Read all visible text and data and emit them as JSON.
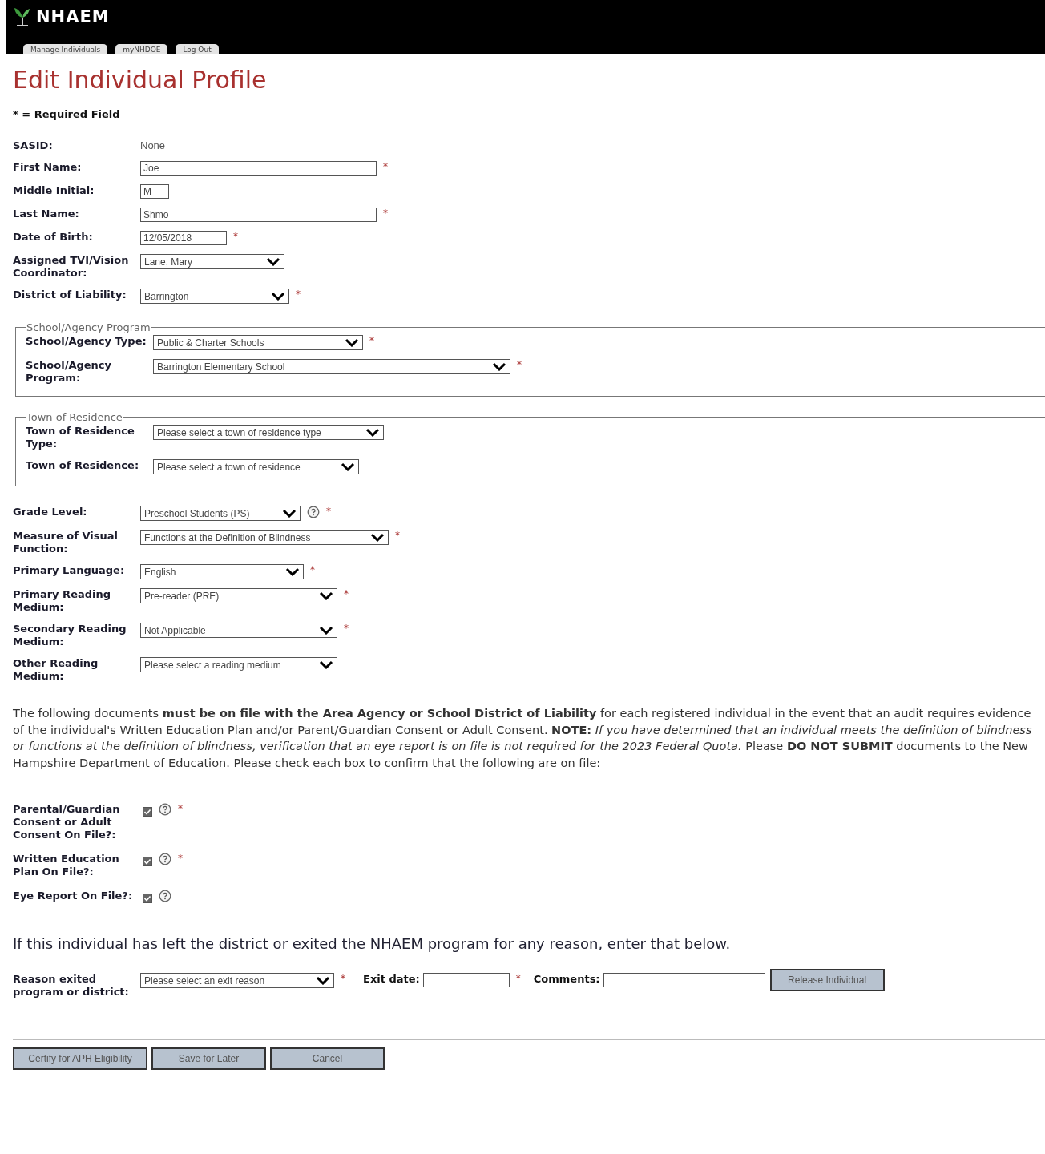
{
  "header": {
    "logo": "NHAEM",
    "tabs": [
      {
        "label": "Manage Individuals",
        "selected": false
      },
      {
        "label": "myNHDOE",
        "selected": false
      },
      {
        "label": "Log Out",
        "selected": false
      }
    ]
  },
  "title": "Edit Individual Profile",
  "required_note": "* = Required Field",
  "fields": [
    {
      "label": "SASID:",
      "kind": "text",
      "value": "None"
    },
    {
      "label": "First Name:",
      "kind": "input",
      "value": "Joe",
      "required_mark": "*"
    },
    {
      "label": "Middle Initial:",
      "kind": "input",
      "value": "M"
    },
    {
      "label": "Last Name:",
      "kind": "input",
      "value": "Shmo",
      "required_mark": "*"
    },
    {
      "label": "Date of Birth:",
      "kind": "input",
      "value": "12/05/2018",
      "required_mark": "*"
    },
    {
      "label": "Assigned TVI/Vision Coordinator:",
      "kind": "select",
      "value": "Lane, Mary"
    },
    {
      "label": "District of Liability:",
      "kind": "select",
      "value": "Barrington",
      "required_mark": "*"
    }
  ],
  "fieldsets": [
    {
      "legend": "School/Agency Program",
      "fields": [
        {
          "label": "School/Agency Type:",
          "kind": "select",
          "value": "Public & Charter Schools",
          "required_mark": "*"
        },
        {
          "label": "School/Agency Program:",
          "kind": "select",
          "value": "Barrington Elementary School",
          "required_mark": "*"
        }
      ]
    },
    {
      "legend": "Town of Residence",
      "fields": [
        {
          "label": "Town of Residence Type:",
          "kind": "select",
          "value": "Please select a town of residence type"
        },
        {
          "label": "Town of Residence:",
          "kind": "select",
          "value": "Please select a town of residence"
        }
      ]
    }
  ],
  "more_fields": [
    {
      "label": "Grade Level:",
      "kind": "select",
      "value": "Preschool Students (PS)",
      "help": true,
      "required_mark": "*"
    },
    {
      "label": "Measure of Visual Function:",
      "kind": "select",
      "value": "Functions at the Definition of Blindness",
      "help": false,
      "required_mark": "*"
    },
    {
      "label": "Primary Language:",
      "kind": "select",
      "value": "English",
      "help": false,
      "required_mark": "*"
    },
    {
      "label": "Primary Reading Medium:",
      "kind": "select",
      "value": "Pre-reader (PRE)",
      "help": false,
      "required_mark": "*"
    },
    {
      "label": "Secondary Reading Medium:",
      "kind": "select",
      "value": "Not Applicable",
      "help": false,
      "required_mark": "*"
    },
    {
      "label": "Other Reading Medium:",
      "kind": "select",
      "value": "Please select a reading medium",
      "help": false
    }
  ],
  "notice": "The following documents **must be on file with the Area Agency or School District of Liability** for each registered individual in the event that an audit requires evidence of the individual's Written Education Plan and/or Parent/Guardian Consent or Adult Consent. **NOTE:** *If you have determined that an individual meets the definition of blindness or functions at the definition of blindness, verification that an eye report is on file is not required for the 2023 Federal Quota.* Please **DO NOT SUBMIT** documents to the New Hampshire Department of Education. Please check each box to confirm that the following are on file:",
  "documents": [
    {
      "label": "Parental/Guardian Consent or Adult Consent On File?:",
      "checked": true,
      "required_mark": "*"
    },
    {
      "label": "Written Education Plan On File?:",
      "checked": true,
      "required_mark": "*"
    },
    {
      "label": "Eye Report On File?:",
      "checked": true
    }
  ],
  "exit_prompt": "If this individual has left the district or exited the NHAEM program for any reason, enter that below.",
  "exit": {
    "reason_label": "Reason exited program or district:",
    "reason_value": "Please select an exit reason",
    "reason_required_mark": "*",
    "date_label": "Exit date:",
    "date_required_mark": "*",
    "comments_label": "Comments:",
    "release_button": "Release Individual"
  },
  "buttons": [
    "Certify for APH Eligibility",
    "Save for Later",
    "Cancel"
  ]
}
